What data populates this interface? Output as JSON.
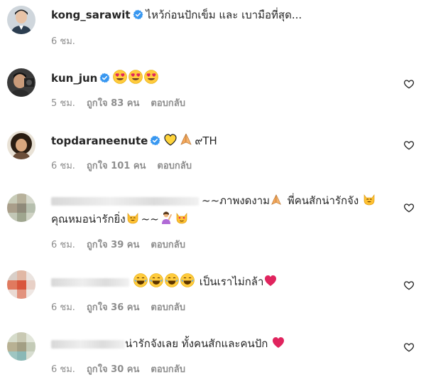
{
  "comments": [
    {
      "username": "kong_sarawit",
      "verified": true,
      "text": "ไหว้ก่อนปักเข็ม และ เบามือที่สุด...",
      "time": "6 ชม."
    },
    {
      "username": "kun_jun",
      "verified": true,
      "emojis": [
        "heart-eyes",
        "heart-eyes",
        "heart-eyes"
      ],
      "time": "5 ชม.",
      "likes": "ถูกใจ 83 คน",
      "reply": "ตอบกลับ"
    },
    {
      "username": "topdaraneenute",
      "verified": true,
      "text_suffix": "๙TH",
      "emojis": [
        "yellow-heart",
        "folded-hands"
      ],
      "time": "6 ชม.",
      "likes": "ถูกใจ 101 คน",
      "reply": "ตอบกลับ"
    },
    {
      "username_hidden": true,
      "text_a": "~~ภาพงดงาม",
      "text_b": " พี่คนสักน่ารักจัง ",
      "text_c": "คุณหมอน่ารักยิ่ง",
      "text_d": "~~",
      "time": "6 ชม.",
      "likes": "ถูกใจ 39 คน",
      "reply": "ตอบกลับ"
    },
    {
      "username_hidden": true,
      "text": " เป็นเราไม่กล้า",
      "time": "6 ชม.",
      "likes": "ถูกใจ 36 คน",
      "reply": "ตอบกลับ"
    },
    {
      "username_hidden": true,
      "text": "น่ารักจังเลย ทั้งคนสักและคนปัก ",
      "time": "6 ชม.",
      "likes": "ถูกใจ 30 คน",
      "reply": "ตอบกลับ"
    }
  ],
  "colors": {
    "verified": "#3897f0",
    "muted": "#8e8e8e",
    "red_heart": "#e0245e"
  }
}
